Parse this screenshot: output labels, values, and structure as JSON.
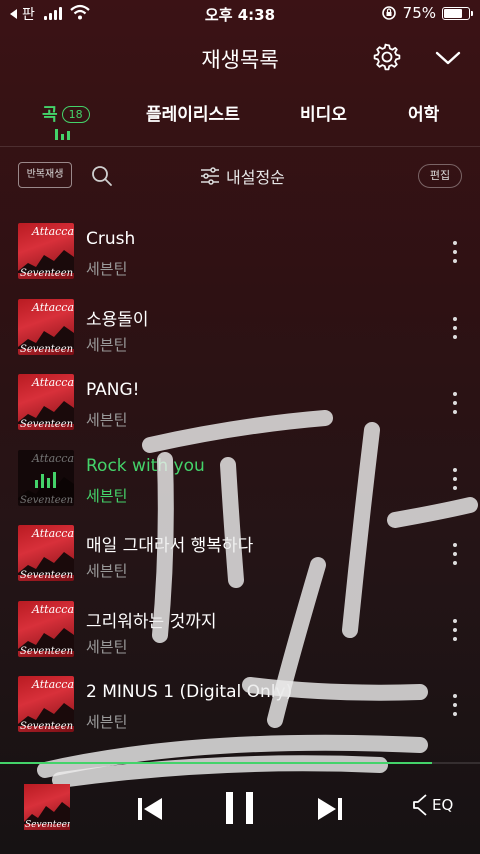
{
  "status_bar": {
    "back_label": "판",
    "time": "오후 4:38",
    "battery_percent": "75%",
    "battery_level": 0.75,
    "icons": [
      "back-arrow-icon",
      "signal-icon",
      "wifi-icon",
      "orientation-lock-icon",
      "battery-icon"
    ]
  },
  "header": {
    "title": "재생목록",
    "icons": [
      "gear-icon",
      "chevron-down-icon"
    ]
  },
  "tabs": {
    "items": [
      {
        "label": "곡",
        "count": "18",
        "active": true
      },
      {
        "label": "플레이리스트"
      },
      {
        "label": "비디오"
      },
      {
        "label": "어학"
      }
    ]
  },
  "toolbar": {
    "repeat_label": "반복재생",
    "sort_label": "내설정순",
    "edit_label": "편집",
    "icons": [
      "search-icon",
      "sort-sliders-icon"
    ]
  },
  "songs": [
    {
      "title": "Crush",
      "artist": "세븐틴",
      "playing": false
    },
    {
      "title": "소용돌이",
      "artist": "세븐틴",
      "playing": false
    },
    {
      "title": "PANG!",
      "artist": "세븐틴",
      "playing": false
    },
    {
      "title": "Rock with you",
      "artist": "세븐틴",
      "playing": true
    },
    {
      "title": "매일 그대라서 행복하다",
      "artist": "세븐틴",
      "playing": false
    },
    {
      "title": "그리워하는 것까지",
      "artist": "세븐틴",
      "playing": false
    },
    {
      "title": "2 MINUS 1 (Digital Only)",
      "artist": "세븐틴",
      "playing": false
    }
  ],
  "album_art": {
    "top_text": "Attacca",
    "bottom_text": "Seventeen"
  },
  "player": {
    "progress": 0.9,
    "eq_label": "EQ",
    "icons": [
      "previous-icon",
      "pause-icon",
      "next-icon",
      "eq-speaker-icon"
    ]
  },
  "colors": {
    "accent": "#44d36a",
    "background": "#2e1113",
    "album_red": "#c8242c"
  },
  "overlay": {
    "handwritten_text": "판"
  }
}
